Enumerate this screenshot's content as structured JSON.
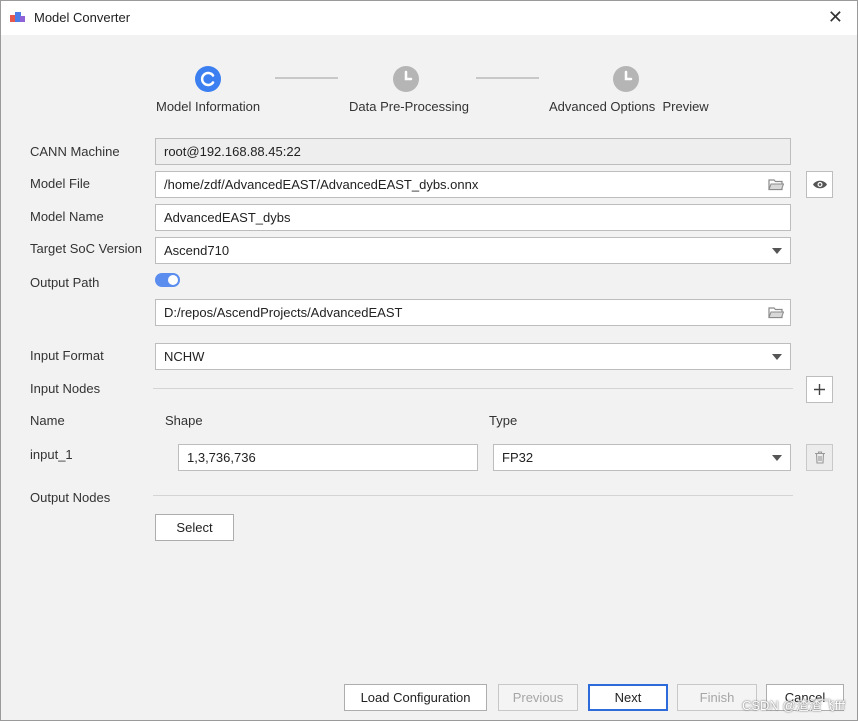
{
  "window": {
    "title": "Model Converter"
  },
  "steps": [
    {
      "label": "Model Information",
      "state": "active"
    },
    {
      "label": "Data Pre-Processing",
      "state": "pending"
    },
    {
      "label": "Advanced Options  Preview",
      "state": "pending"
    }
  ],
  "form": {
    "cann_machine": {
      "label": "CANN Machine",
      "value": "root@192.168.88.45:22"
    },
    "model_file": {
      "label": "Model File",
      "value": "/home/zdf/AdvancedEAST/AdvancedEAST_dybs.onnx"
    },
    "model_name": {
      "label": "Model Name",
      "value": "AdvancedEAST_dybs"
    },
    "target_soc": {
      "label": "Target SoC Version",
      "value": "Ascend710"
    },
    "output_path": {
      "label": "Output Path",
      "value": "D:/repos/AscendProjects/AdvancedEAST",
      "toggle_on": true
    },
    "input_format": {
      "label": "Input Format",
      "value": "NCHW"
    }
  },
  "input_nodes": {
    "label": "Input Nodes",
    "columns": [
      "Name",
      "Shape",
      "Type"
    ],
    "rows": [
      {
        "name": "input_1",
        "shape": "1,3,736,736",
        "type": "FP32"
      }
    ]
  },
  "output_nodes": {
    "label": "Output Nodes",
    "select_label": "Select"
  },
  "footer": {
    "load_configuration": "Load Configuration",
    "previous": "Previous",
    "next": "Next",
    "finish": "Finish",
    "cancel": "Cancel"
  },
  "watermark": "CSDN @渣渣飞fff",
  "colors": {
    "accent": "#5b8def",
    "step_active": "#3b7ff0",
    "step_pending": "#b5b5b5"
  }
}
